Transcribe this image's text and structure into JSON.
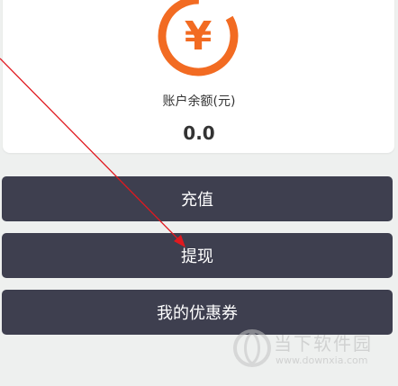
{
  "balance": {
    "icon": "yen-icon",
    "icon_glyph": "¥",
    "label": "账户余额(元)",
    "value": "0.0"
  },
  "actions": {
    "recharge_label": "充值",
    "withdraw_label": "提现",
    "coupons_label": "我的优惠券"
  },
  "watermark": {
    "title": "当下软件园",
    "url": "www.downxia.com"
  },
  "colors": {
    "accent_orange": "#f26b22",
    "button_bg": "#3e3f4f",
    "annotation_red": "#e0191f"
  }
}
